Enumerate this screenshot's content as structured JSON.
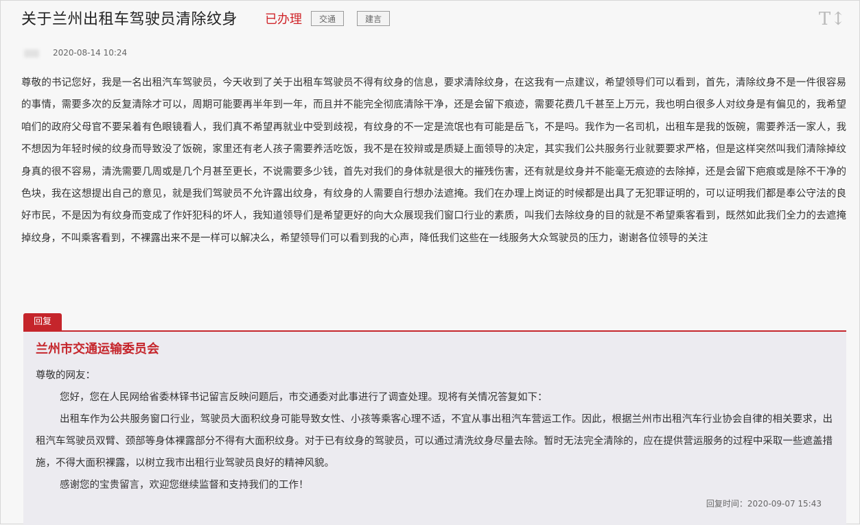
{
  "post": {
    "title": "关于兰州出租车驾驶员清除纹身",
    "status": "已办理",
    "category_tag": "交通",
    "type_tag": "建言",
    "font_size_icon": "T↕",
    "date": "2020-08-14 10:24",
    "content": "尊敬的书记您好，我是一名出租汽车驾驶员，今天收到了关于出租车驾驶员不得有纹身的信息，要求清除纹身，在这我有一点建议，希望领导们可以看到，首先，清除纹身不是一件很容易的事情，需要多次的反复清除才可以，周期可能要再半年到一年，而且并不能完全彻底清除干净，还是会留下痕迹，需要花费几千甚至上万元，我也明白很多人对纹身是有偏见的，我希望咱们的政府父母官不要呆着有色眼镜看人，我们真不希望再就业中受到歧视，有纹身的不一定是流氓也有可能是岳飞，不是吗。我作为一名司机，出租车是我的饭碗，需要养活一家人，我不想因为年轻时候的纹身而导致没了饭碗，家里还有老人孩子需要养活吃饭，我不是在狡辩或是质疑上面领导的决定，其实我们公共服务行业就要要求严格，但是这样突然叫我们清除掉纹身真的很不容易，清洗需要几周或是几个月甚至更长，不说需要多少钱，首先对我们的身体就是很大的摧残伤害，还有就是纹身并不能毫无痕迹的去除掉，还是会留下疤痕或是除不干净的色块，我在这想提出自己的意见，就是我们驾驶员不允许露出纹身，有纹身的人需要自行想办法遮掩。我们在办理上岗证的时候都是出具了无犯罪证明的，可以证明我们都是奉公守法的良好市民，不是因为有纹身而变成了作奸犯科的坏人，我知道领导们是希望更好的向大众展现我们窗口行业的素质，叫我们去除纹身的目的就是不希望乘客看到，既然如此我们全力的去遮掩掉纹身，不叫乘客看到，不裸露出来不是一样可以解决么，希望领导们可以看到我的心声，降低我们这些在一线服务大众驾驶员的压力，谢谢各位领导的关注"
  },
  "reply": {
    "badge": "回复",
    "org": "兰州市交通运输委员会",
    "greeting": "尊敬的网友：",
    "paragraphs": [
      "您好，您在人民网给省委林铎书记留言反映问题后，市交通委对此事进行了调查处理。现将有关情况答复如下：",
      "出租车作为公共服务窗口行业，驾驶员大面积纹身可能导致女性、小孩等乘客心理不适，不宜从事出租汽车营运工作。因此，根据兰州市出租汽车行业协会自律的相关要求，出租汽车驾驶员双臂、颈部等身体裸露部分不得有大面积纹身。对于已有纹身的驾驶员，可以通过清洗纹身尽量去除。暂时无法完全清除的，应在提供营运服务的过程中采取一些遮盖措施，不得大面积裸露，以树立我市出租行业驾驶员良好的精神风貌。",
      "感谢您的宝贵留言，欢迎您继续监督和支持我们的工作！"
    ],
    "time_label": "回复时间：2020-09-07 15:43"
  }
}
